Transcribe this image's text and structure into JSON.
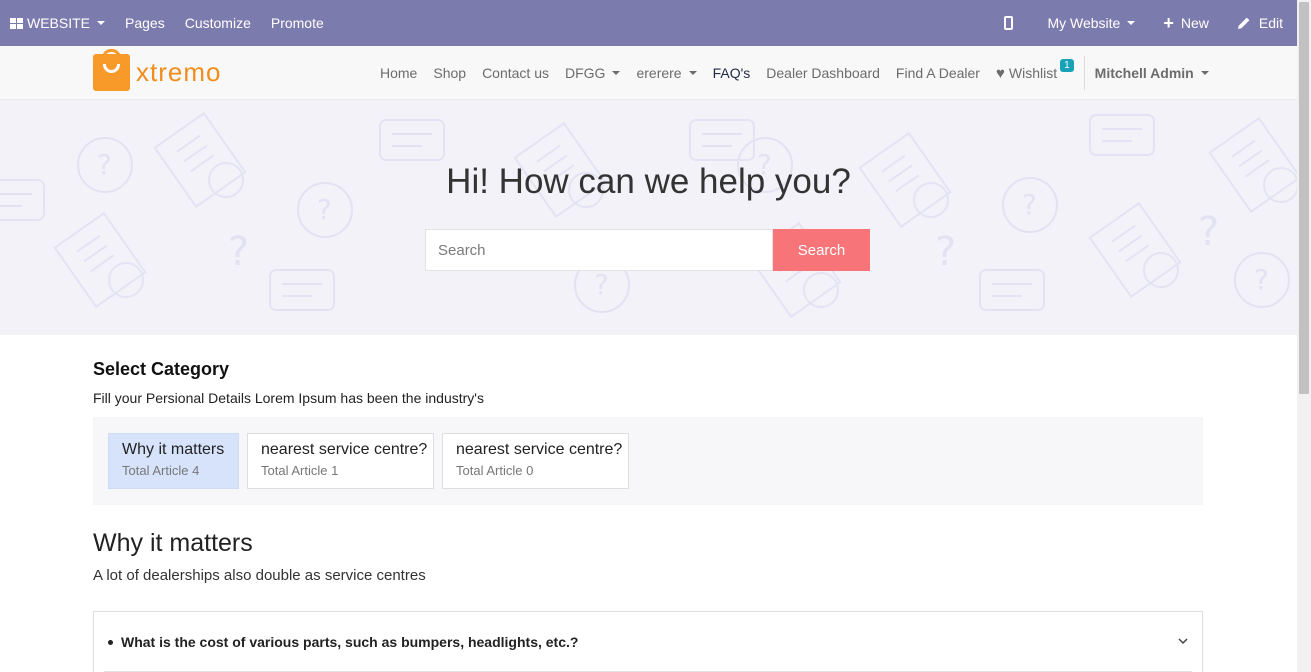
{
  "adminbar": {
    "app_label": "WEBSITE",
    "menu": [
      "Pages",
      "Customize",
      "Promote"
    ],
    "mobile_icon": "mobile-phone-icon",
    "website_selector": "My Website",
    "new_label": "New",
    "edit_label": "Edit",
    "color": "#7c7bad"
  },
  "header": {
    "logo_text": "xtremo",
    "nav": {
      "home": "Home",
      "shop": "Shop",
      "contact": "Contact us",
      "dfgg": "DFGG",
      "ererere": "ererere",
      "faqs": "FAQ's",
      "dealer_dashboard": "Dealer Dashboard",
      "find_dealer": "Find A Dealer",
      "wishlist": "Wishlist",
      "wishlist_count": "1",
      "user": "Mitchell Admin"
    }
  },
  "hero": {
    "title": "Hi! How can we help you?",
    "search_placeholder": "Search",
    "search_button": "Search",
    "button_color": "#f77479"
  },
  "category": {
    "title": "Select Category",
    "description": "Fill your Persional Details Lorem Ipsum has been the industry's",
    "cards": [
      {
        "title": "Why it matters",
        "subtitle": "Total Article 4"
      },
      {
        "title": "nearest service centre?",
        "subtitle": "Total Article 1"
      },
      {
        "title": "nearest service centre?",
        "subtitle": "Total Article 0"
      }
    ]
  },
  "topic": {
    "title": "Why it matters",
    "description": "A lot of dealerships also double as service centres"
  },
  "faq": {
    "questions": [
      "What is the cost of various parts, such as bumpers, headlights, etc.?"
    ]
  }
}
